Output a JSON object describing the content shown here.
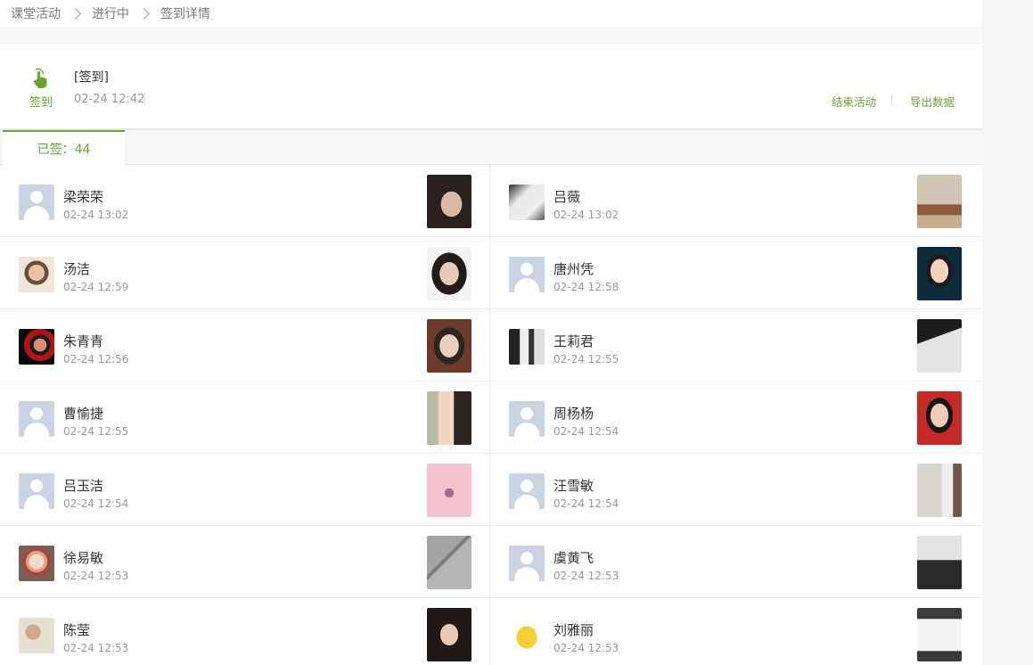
{
  "breadcrumb": [
    "课堂活动",
    "进行中",
    "签到详情"
  ],
  "activity": {
    "type_label": "签到",
    "title": "[签到]",
    "time": "02-24 12:42",
    "end_button": "结束活动",
    "export_button": "导出数据",
    "icon": "hand-pointer-icon"
  },
  "tab": {
    "label": "已签：44"
  },
  "accent_color": "#6aa330",
  "students": [
    {
      "name": "梁荣荣",
      "time": "02-24 13:02",
      "avatar": "default"
    },
    {
      "name": "吕薇",
      "time": "02-24 13:02",
      "avatar": "photo"
    },
    {
      "name": "汤洁",
      "time": "02-24 12:59",
      "avatar": "photo"
    },
    {
      "name": "唐州凭",
      "time": "02-24 12:58",
      "avatar": "default"
    },
    {
      "name": "朱青青",
      "time": "02-24 12:56",
      "avatar": "photo"
    },
    {
      "name": "王莉君",
      "time": "02-24 12:55",
      "avatar": "photo"
    },
    {
      "name": "曹愉捷",
      "time": "02-24 12:55",
      "avatar": "default"
    },
    {
      "name": "周杨杨",
      "time": "02-24 12:54",
      "avatar": "default"
    },
    {
      "name": "吕玉洁",
      "time": "02-24 12:54",
      "avatar": "default"
    },
    {
      "name": "汪雪敏",
      "time": "02-24 12:54",
      "avatar": "default"
    },
    {
      "name": "徐易敏",
      "time": "02-24 12:53",
      "avatar": "photo"
    },
    {
      "name": "虞黄飞",
      "time": "02-24 12:53",
      "avatar": "default"
    },
    {
      "name": "陈莹",
      "time": "02-24 12:53",
      "avatar": "photo"
    },
    {
      "name": "刘雅丽",
      "time": "02-24 12:53",
      "avatar": "photo"
    }
  ]
}
